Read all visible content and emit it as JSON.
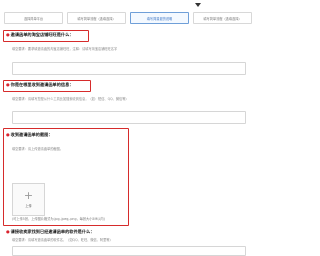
{
  "tabs": [
    {
      "label": "选择简单平台"
    },
    {
      "label": "填写简单流程（选填选择）"
    },
    {
      "label": "填写简易退货说明",
      "active": true
    },
    {
      "label": "填写简单流程（选填选择）"
    }
  ],
  "questions": [
    {
      "title": "邀请函单的淘宝店铺旺旺是什么：",
      "hint": "填空要求：要求填邀请函的淘宝店铺旺旺，注释：请填写淘宝店铺旺旺名字",
      "input_value": ""
    },
    {
      "title": "你是在哪里收到邀请函单的信息：",
      "hint": "填空要求：请填写您是从什么工具比如搜索收到信息，（如：短信、QQ、微信等）",
      "input_value": ""
    },
    {
      "title": "收到邀请函单的截图：",
      "hint": "填空要求：请上传邀请函单的截图。"
    },
    {
      "title": "请接收卖家找到已经邀请函单的软件是什么：",
      "hint": "填空要求：请填写邀请函单的软件名，（如QQ、旺旺、微信、阿里等）",
      "input_value": ""
    }
  ],
  "upload": {
    "plus_symbol": "+",
    "label": "上传",
    "note": "(可上传5张，上传图片格式为.jpg,.jpeg,.png，每张大小5M以内)"
  },
  "colors": {
    "highlight": "#d62b2b",
    "active_tab": "#3a74c4",
    "bullet": "#d9232d"
  }
}
